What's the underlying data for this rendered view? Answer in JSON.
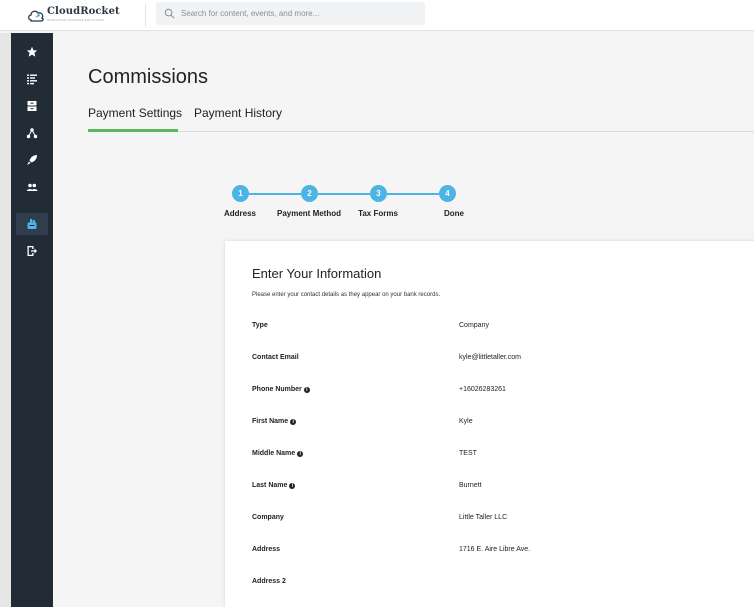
{
  "app": {
    "name": "CloudRocket",
    "tagline": "INNOVATIVE STORAGE SOLUTIONS"
  },
  "search": {
    "placeholder": "Search for content, events, and more..."
  },
  "sidebar": {
    "items": [
      {
        "icon": "star-icon"
      },
      {
        "icon": "list-icon"
      },
      {
        "icon": "storage-icon"
      },
      {
        "icon": "network-icon"
      },
      {
        "icon": "rocket-icon"
      },
      {
        "icon": "users-icon"
      },
      {
        "icon": "commissions-icon",
        "active": true
      },
      {
        "icon": "logout-icon"
      }
    ]
  },
  "page": {
    "title": "Commissions",
    "tabs": [
      {
        "label": "Payment Settings",
        "active": true
      },
      {
        "label": "Payment History",
        "active": false
      }
    ]
  },
  "stepper": {
    "steps": [
      {
        "number": "1",
        "label": "Address"
      },
      {
        "number": "2",
        "label": "Payment Method"
      },
      {
        "number": "3",
        "label": "Tax Forms"
      },
      {
        "number": "4",
        "label": "Done"
      }
    ]
  },
  "form": {
    "title": "Enter Your Information",
    "subtitle": "Please enter your contact details as they appear on your bank records.",
    "rows": [
      {
        "label": "Type",
        "value": "Company",
        "info": false
      },
      {
        "label": "Contact Email",
        "value": "kyle@littletaller.com",
        "info": false
      },
      {
        "label": "Phone Number",
        "value": "+16026283261",
        "info": true
      },
      {
        "label": "First Name",
        "value": "Kyle",
        "info": true
      },
      {
        "label": "Middle Name",
        "value": "TEST",
        "info": true
      },
      {
        "label": "Last Name",
        "value": "Burnett",
        "info": true
      },
      {
        "label": "Company",
        "value": "Little Taller LLC",
        "info": false
      },
      {
        "label": "Address",
        "value": "1716 E. Aire Libre Ave.",
        "info": false
      },
      {
        "label": "Address 2",
        "value": "",
        "info": false
      }
    ]
  },
  "colors": {
    "sidebar_bg": "#222c37",
    "accent_green": "#5cb85c",
    "step_blue": "#4cb5e6"
  }
}
